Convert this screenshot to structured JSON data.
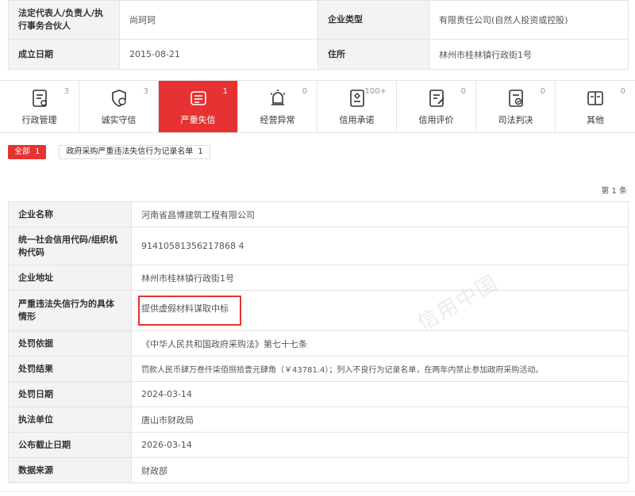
{
  "company_info": {
    "legal_rep_label": "法定代表人/负责人/执行事务合伙人",
    "legal_rep_value": "尚珂珂",
    "type_label": "企业类型",
    "type_value": "有限责任公司(自然人投资或控股)",
    "founded_label": "成立日期",
    "founded_value": "2015-08-21",
    "address_label": "住所",
    "address_value": "林州市桂林镇行政街1号"
  },
  "tabs": [
    {
      "label": "行政管理",
      "count": "3",
      "icon": "admin-icon"
    },
    {
      "label": "诚实守信",
      "count": "3",
      "icon": "honesty-icon"
    },
    {
      "label": "严重失信",
      "count": "1",
      "icon": "serious-dishonesty-icon",
      "active": true
    },
    {
      "label": "经营异常",
      "count": "0",
      "icon": "alarm-icon"
    },
    {
      "label": "信用承诺",
      "count": "100+",
      "icon": "promise-icon"
    },
    {
      "label": "信用评价",
      "count": "0",
      "icon": "evaluation-icon"
    },
    {
      "label": "司法判决",
      "count": "0",
      "icon": "judgment-icon"
    },
    {
      "label": "其他",
      "count": "0",
      "icon": "other-icon"
    }
  ],
  "filters": {
    "all_label": "全部",
    "all_count": "1",
    "list_label": "政府采购严重违法失信行为记录名单",
    "list_count": "1"
  },
  "page_count": "第 1 条",
  "watermark": "信用中国",
  "details": [
    {
      "label": "企业名称",
      "value": "河南省昌博建筑工程有限公司"
    },
    {
      "label": "统一社会信用代码/组织机构代码",
      "value": "91410581356217868 4"
    },
    {
      "label": "企业地址",
      "value": "林州市桂林镇行政街1号"
    },
    {
      "label": "严重违法失信行为的具体情形",
      "value": "提供虚假材料谋取中标"
    },
    {
      "label": "处罚依据",
      "value": "《中华人民共和国政府采购法》第七十七条"
    },
    {
      "label": "处罚结果",
      "value": "罚款人民币肆万叁仟柒佰捌拾壹元肆角（￥43781.4）；列入不良行为记录名单，在两年内禁止参加政府采购活动。"
    },
    {
      "label": "处罚日期",
      "value": "2024-03-14"
    },
    {
      "label": "执法单位",
      "value": "唐山市财政局"
    },
    {
      "label": "公布截止日期",
      "value": "2026-03-14"
    },
    {
      "label": "数据来源",
      "value": "财政部"
    }
  ]
}
